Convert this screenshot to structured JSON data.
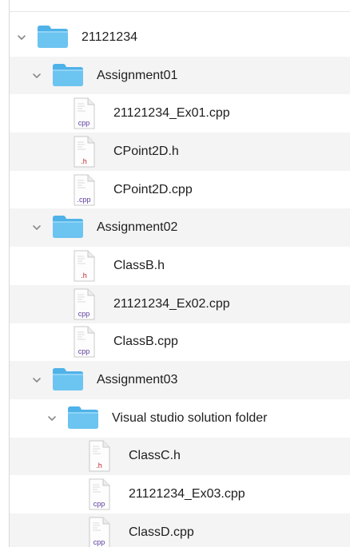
{
  "tree": [
    {
      "label": "21121234",
      "kind": "folder",
      "depth": 0,
      "expanded": true
    },
    {
      "label": "Assignment01",
      "kind": "folder",
      "depth": 1,
      "expanded": true
    },
    {
      "label": "21121234_Ex01.cpp",
      "kind": "file",
      "depth": 2,
      "ext": "cpp",
      "icon": "cpp-file-icon"
    },
    {
      "label": "CPoint2D.h",
      "kind": "file",
      "depth": 2,
      "ext": ".h",
      "icon": "header-file-icon"
    },
    {
      "label": "CPoint2D.cpp",
      "kind": "file",
      "depth": 2,
      "ext": ".cpp",
      "icon": "cpp-file-icon"
    },
    {
      "label": "Assignment02",
      "kind": "folder",
      "depth": 1,
      "expanded": true
    },
    {
      "label": "ClassB.h",
      "kind": "file",
      "depth": 2,
      "ext": ".h",
      "icon": "header-file-icon"
    },
    {
      "label": "21121234_Ex02.cpp",
      "kind": "file",
      "depth": 2,
      "ext": "cpp",
      "icon": "cpp-file-icon"
    },
    {
      "label": "ClassB.cpp",
      "kind": "file",
      "depth": 2,
      "ext": "cpp",
      "icon": "cpp-file-icon"
    },
    {
      "label": "Assignment03",
      "kind": "folder",
      "depth": 1,
      "expanded": true
    },
    {
      "label": "Visual studio solution folder",
      "kind": "folder",
      "depth": 2,
      "expanded": true
    },
    {
      "label": "ClassC.h",
      "kind": "file",
      "depth": 3,
      "ext": ".h",
      "icon": "header-file-icon"
    },
    {
      "label": "21121234_Ex03.cpp",
      "kind": "file",
      "depth": 3,
      "ext": "cpp",
      "icon": "cpp-file-icon"
    },
    {
      "label": "ClassD.cpp",
      "kind": "file",
      "depth": 3,
      "ext": "cpp",
      "icon": "cpp-file-icon"
    }
  ],
  "colors": {
    "folder_body": "#6cc4f0",
    "folder_tab": "#4fb2e8",
    "cpp_tag": "#5b3a9e",
    "h_tag": "#c0262c",
    "row_alt": "#f4f4f4",
    "text": "#1e1e1e"
  }
}
